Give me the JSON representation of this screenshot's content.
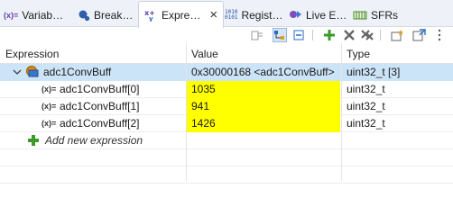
{
  "tabs": [
    {
      "label": "Variab…",
      "icon": "variables-icon"
    },
    {
      "label": "Break…",
      "icon": "breakpoints-icon"
    },
    {
      "label": "Expre…",
      "icon": "expressions-icon",
      "active": true
    },
    {
      "label": "Regist…",
      "icon": "registers-icon"
    },
    {
      "label": "Live E…",
      "icon": "live-expressions-icon"
    },
    {
      "label": "SFRs",
      "icon": "sfrs-icon"
    }
  ],
  "tab_icon_text": {
    "variables": "(x)=",
    "registers_top": "1010",
    "registers_bottom": "0101"
  },
  "tab_close": "×",
  "toolbar": {
    "buttons": [
      "show-type-names-icon",
      "show-logical-structure-icon",
      "collapse-all-icon",
      "add-expression-icon",
      "remove-selected-icon",
      "remove-all-icon",
      "new-view-icon",
      "view-menu-icon"
    ]
  },
  "columns": {
    "expression": "Expression",
    "value": "Value",
    "type": "Type"
  },
  "rows": [
    {
      "expression": "adc1ConvBuff",
      "value": "0x30000168 <adc1ConvBuff>",
      "type": "uint32_t [3]"
    },
    {
      "expression": "adc1ConvBuff[0]",
      "value": "1035",
      "type": "uint32_t"
    },
    {
      "expression": "adc1ConvBuff[1]",
      "value": "941",
      "type": "uint32_t"
    },
    {
      "expression": "adc1ConvBuff[2]",
      "value": "1426",
      "type": "uint32_t"
    }
  ],
  "child_icon_text": "(x)=",
  "add_new_expression": "Add new expression",
  "colors": {
    "selection": "#cce4f7",
    "changed_value": "#ffff00",
    "accent": "#2a6bc2"
  }
}
